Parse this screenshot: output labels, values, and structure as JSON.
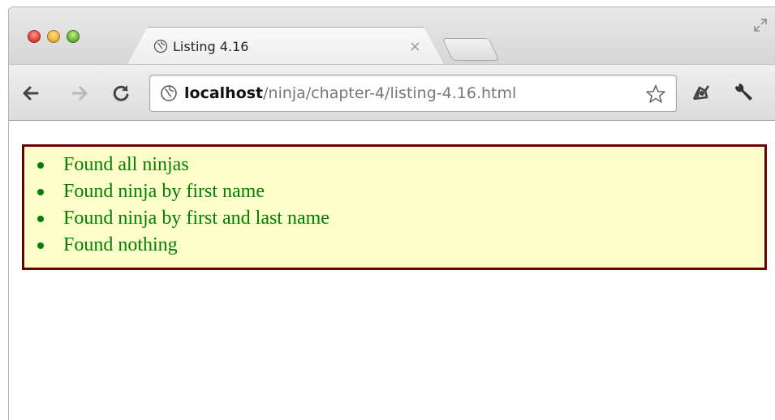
{
  "browser": {
    "tab": {
      "title": "Listing 4.16",
      "close_glyph": "×"
    },
    "address": {
      "host": "localhost",
      "path": "/ninja/chapter-4/listing-4.16.html"
    },
    "icons": {
      "back": "arrow-left-icon",
      "forward": "arrow-right-icon",
      "reload": "reload-icon",
      "page": "globe-icon",
      "bookmark": "star-icon",
      "extension": "extension-icon",
      "menu": "wrench-icon",
      "fullscreen": "expand-icon"
    }
  },
  "page": {
    "results": [
      "Found all ninjas",
      "Found ninja by first name",
      "Found ninja by first and last name",
      "Found nothing"
    ],
    "colors": {
      "text": "#008000",
      "box_background": "#ffffcc",
      "box_border": "#6b0000"
    }
  }
}
